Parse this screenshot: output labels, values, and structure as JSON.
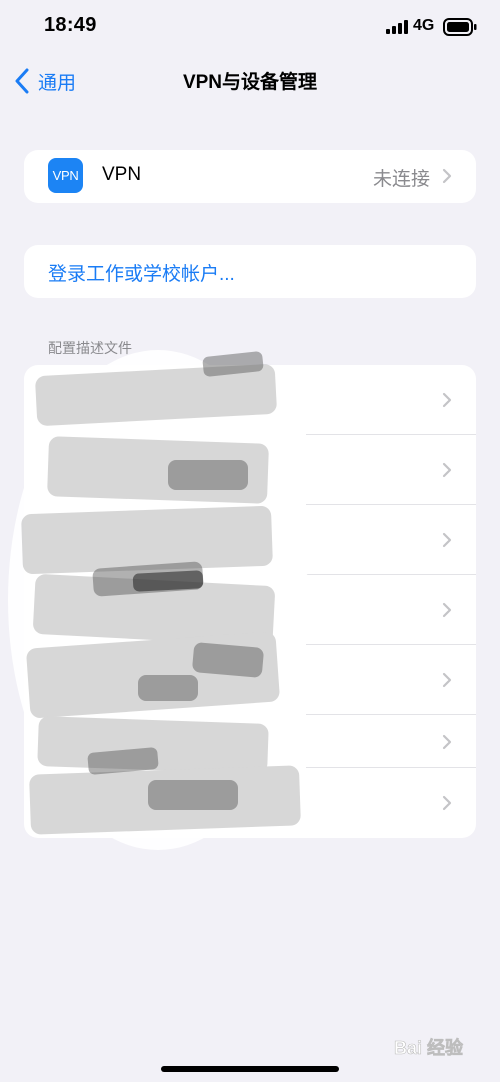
{
  "status_bar": {
    "time": "18:49",
    "network": "4G",
    "icons": [
      "signal-bars-icon",
      "battery-icon"
    ]
  },
  "nav": {
    "back_label": "通用",
    "title": "VPN与设备管理"
  },
  "vpn": {
    "badge": "VPN",
    "label": "VPN",
    "status": "未连接"
  },
  "login": {
    "label": "登录工作或学校帐户..."
  },
  "profiles": {
    "header": "配置描述文件",
    "rows": 7,
    "redacted": true
  },
  "colors": {
    "background": "#f2f1f7",
    "accent": "#1a7cf5",
    "vpn_badge": "#1c84f4",
    "secondary_text": "#8a8a8e"
  },
  "watermark": {
    "text": "Bai 经验"
  }
}
